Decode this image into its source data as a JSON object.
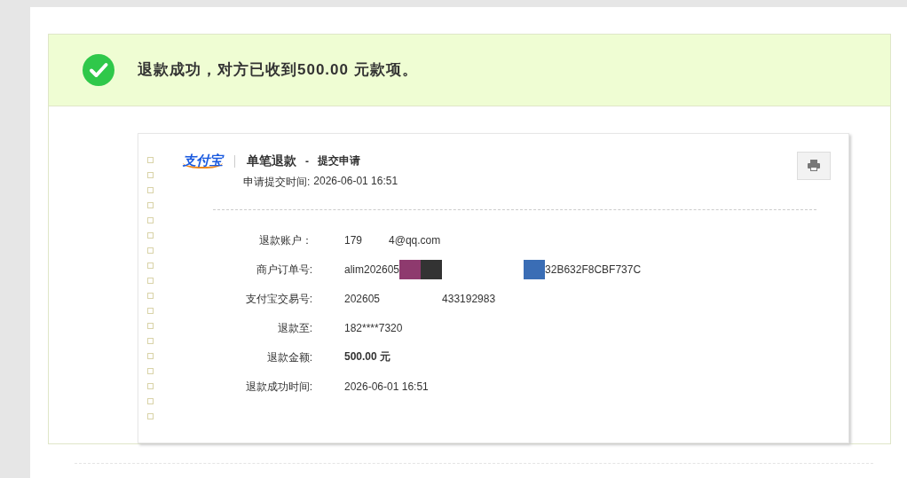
{
  "banner": {
    "message": "退款成功，对方已收到**500.00** 元款项。"
  },
  "receipt": {
    "logo": "支付宝",
    "title": "单笔退款",
    "separator": "-",
    "subtitle": "提交申请",
    "submitted_label": "申请提交时间:",
    "submitted_time": "2026-06-01 16:51",
    "rows": [
      {
        "label": "退款账户：",
        "bold": false,
        "segments": [
          {
            "kind": "text",
            "text": "179"
          },
          {
            "kind": "blank"
          },
          {
            "kind": "text",
            "text": "4@qq.com"
          }
        ]
      },
      {
        "label": "商户订单号:",
        "bold": false,
        "segments": [
          {
            "kind": "text",
            "text": "alim202605"
          },
          {
            "kind": "redaction",
            "color": "#8e3a6e"
          },
          {
            "kind": "redaction",
            "color": "#333333"
          },
          {
            "kind": "blank"
          },
          {
            "kind": "redaction",
            "color": "#3a6db5"
          },
          {
            "kind": "text",
            "text": "32B632F8CBF737C"
          }
        ]
      },
      {
        "label": "支付宝交易号:",
        "bold": false,
        "segments": [
          {
            "kind": "text",
            "text": "202605"
          },
          {
            "kind": "blank"
          },
          {
            "kind": "text",
            "text": "433192983"
          }
        ]
      },
      {
        "label": "退款至:",
        "bold": false,
        "segments": [
          {
            "kind": "text",
            "text": "182****7320"
          }
        ]
      },
      {
        "label": "退款金额:",
        "bold": true,
        "segments": [
          {
            "kind": "text",
            "text": "500.00 元"
          }
        ]
      },
      {
        "label": "退款成功时间:",
        "bold": false,
        "segments": [
          {
            "kind": "text",
            "text": "2026-06-01 16:51"
          }
        ]
      }
    ]
  }
}
